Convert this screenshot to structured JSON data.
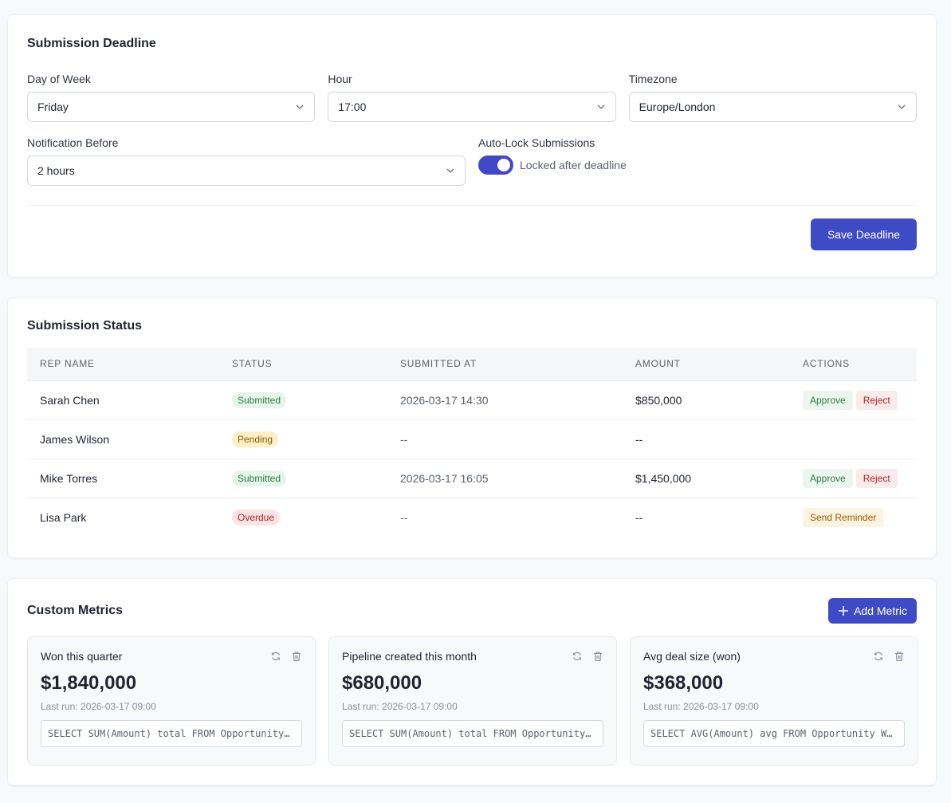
{
  "deadline": {
    "title": "Submission Deadline",
    "day_label": "Day of Week",
    "day_value": "Friday",
    "hour_label": "Hour",
    "hour_value": "17:00",
    "tz_label": "Timezone",
    "tz_value": "Europe/London",
    "notify_label": "Notification Before",
    "notify_value": "2 hours",
    "autolock_label": "Auto-Lock Submissions",
    "autolock_text": "Locked after deadline",
    "autolock_on": true,
    "save_label": "Save Deadline"
  },
  "status": {
    "title": "Submission Status",
    "columns": [
      "REP NAME",
      "STATUS",
      "SUBMITTED AT",
      "AMOUNT",
      "ACTIONS"
    ],
    "rows": [
      {
        "name": "Sarah Chen",
        "status": "Submitted",
        "submitted_at": "2026-03-17 14:30",
        "amount": "$850,000",
        "actions": [
          "Approve",
          "Reject"
        ]
      },
      {
        "name": "James Wilson",
        "status": "Pending",
        "submitted_at": "--",
        "amount": "--",
        "actions": []
      },
      {
        "name": "Mike Torres",
        "status": "Submitted",
        "submitted_at": "2026-03-17 16:05",
        "amount": "$1,450,000",
        "actions": [
          "Approve",
          "Reject"
        ]
      },
      {
        "name": "Lisa Park",
        "status": "Overdue",
        "submitted_at": "--",
        "amount": "--",
        "actions": [
          "Send Reminder"
        ]
      }
    ]
  },
  "metrics": {
    "title": "Custom Metrics",
    "add_label": "Add Metric",
    "items": [
      {
        "name": "Won this quarter",
        "value": "$1,840,000",
        "last_run": "Last run: 2026-03-17 09:00",
        "query": "SELECT SUM(Amount) total FROM Opportunity WHERE IsWon = true AND CloseDate = THIS_QUARTER"
      },
      {
        "name": "Pipeline created this month",
        "value": "$680,000",
        "last_run": "Last run: 2026-03-17 09:00",
        "query": "SELECT SUM(Amount) total FROM Opportunity WHERE CreatedDate = THIS_MONTH"
      },
      {
        "name": "Avg deal size (won)",
        "value": "$368,000",
        "last_run": "Last run: 2026-03-17 09:00",
        "query": "SELECT AVG(Amount) avg FROM Opportunity WHERE IsWon = true"
      }
    ]
  },
  "colors": {
    "accent": "#3f4bc4",
    "success": "#2e7d45",
    "warning": "#8a5a00",
    "danger": "#b42323"
  }
}
